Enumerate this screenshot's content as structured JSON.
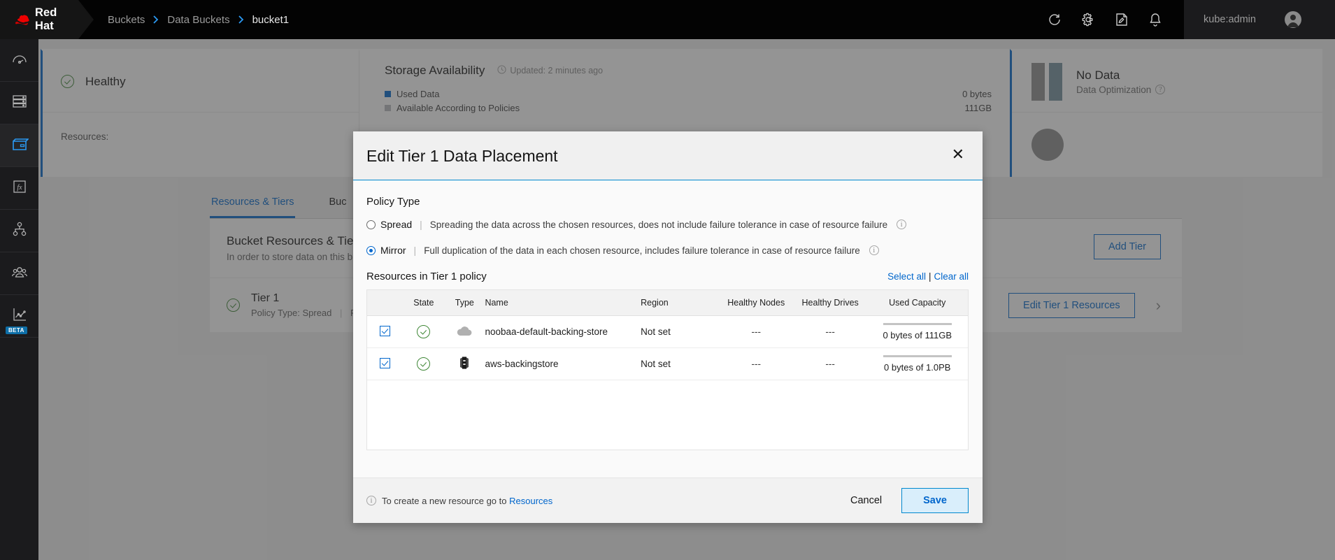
{
  "masthead": {
    "brand": "Red Hat",
    "brand_icon": "redhat-fedora-logo",
    "breadcrumb": [
      {
        "label": "Buckets",
        "current": false
      },
      {
        "label": "Data Buckets",
        "current": false
      },
      {
        "label": "bucket1",
        "current": true
      }
    ],
    "icons": [
      {
        "name": "refresh-icon",
        "glyph": "refresh"
      },
      {
        "name": "gear-icon",
        "glyph": "gear"
      },
      {
        "name": "edit-icon",
        "glyph": "edit"
      },
      {
        "name": "bell-icon",
        "glyph": "bell"
      }
    ],
    "user": "kube:admin",
    "avatar_icon": "user-avatar-icon"
  },
  "rail": {
    "items": [
      {
        "name": "dashboard",
        "icon": "gauge-icon",
        "active": false,
        "beta": ""
      },
      {
        "name": "storage",
        "icon": "server-stack-icon",
        "active": false,
        "beta": ""
      },
      {
        "name": "buckets",
        "icon": "bucket-icon",
        "active": true,
        "beta": ""
      },
      {
        "name": "functions",
        "icon": "fx-icon",
        "active": false,
        "beta": ""
      },
      {
        "name": "topology",
        "icon": "hierarchy-icon",
        "active": false,
        "beta": ""
      },
      {
        "name": "accounts",
        "icon": "users-icon",
        "active": false,
        "beta": ""
      },
      {
        "name": "analytics",
        "icon": "line-chart-icon",
        "active": false,
        "beta": "BETA"
      }
    ]
  },
  "background": {
    "health_card": {
      "status": "Healthy",
      "status_icon": "check-circle-icon",
      "resources_label": "Resources:"
    },
    "storage_card": {
      "title": "Storage Availability",
      "updated": "Updated: 2 minutes ago",
      "updated_icon": "clock-icon",
      "legend": [
        {
          "label": "Used Data",
          "value": "0 bytes",
          "color": "#06c"
        },
        {
          "label": "Available According to Policies",
          "value": "111GB",
          "color": "#b8bbbe"
        }
      ]
    },
    "optimization_card": {
      "headline": "No Data",
      "subtitle": "Data Optimization",
      "info_icon": "help-circle-icon"
    },
    "tabs": [
      {
        "label": "Resources & Tiers",
        "active": true
      },
      {
        "label": "Buc",
        "active": false
      }
    ],
    "panel": {
      "title": "Bucket Resources & Tiering",
      "subtitle": "In order to store data on this bu",
      "add_tier_label": "Add Tier"
    },
    "tier": {
      "name": "Tier 1",
      "meta": "Policy Type: Spread",
      "meta2": "P",
      "status_icon": "check-circle-icon",
      "edit_label": "Edit Tier 1 Resources",
      "chevron_icon": "chevron-right-icon"
    }
  },
  "modal": {
    "title": "Edit Tier 1 Data Placement",
    "close_icon": "close-icon",
    "policy_type_label": "Policy Type",
    "policy_options": [
      {
        "id": "spread",
        "label": "Spread",
        "description": "Spreading the data across the chosen resources, does not include failure tolerance in case of resource failure",
        "selected": false,
        "info_icon": "info-circle-icon"
      },
      {
        "id": "mirror",
        "label": "Mirror",
        "description": "Full duplication of the data in each chosen resource, includes failure tolerance in case of resource failure",
        "selected": true,
        "info_icon": "info-circle-icon"
      }
    ],
    "resources_title": "Resources in Tier 1 policy",
    "select_all_label": "Select all",
    "clear_all_label": "Clear all",
    "table": {
      "columns": [
        "",
        "State",
        "Type",
        "Name",
        "Region",
        "Healthy Nodes",
        "Healthy Drives",
        "Used Capacity"
      ],
      "rows": [
        {
          "checked": true,
          "state_icon": "check-circle-icon",
          "type_icon": "cloud-icon",
          "name": "noobaa-default-backing-store",
          "region": "Not set",
          "healthy_nodes": "---",
          "healthy_drives": "---",
          "used_capacity": "0 bytes of 111GB"
        },
        {
          "checked": true,
          "state_icon": "check-circle-icon",
          "type_icon": "aws-s3-icon",
          "name": "aws-backingstore",
          "region": "Not set",
          "healthy_nodes": "---",
          "healthy_drives": "---",
          "used_capacity": "0 bytes of 1.0PB"
        }
      ]
    },
    "footer_note_prefix": "To create a new resource go to ",
    "footer_note_link": "Resources",
    "footer_info_icon": "info-circle-icon",
    "cancel_label": "Cancel",
    "save_label": "Save"
  },
  "colors": {
    "accent_blue": "#06c",
    "link_blue": "#0088ce",
    "success_green": "#3e8635",
    "masthead_bg": "#030303"
  }
}
